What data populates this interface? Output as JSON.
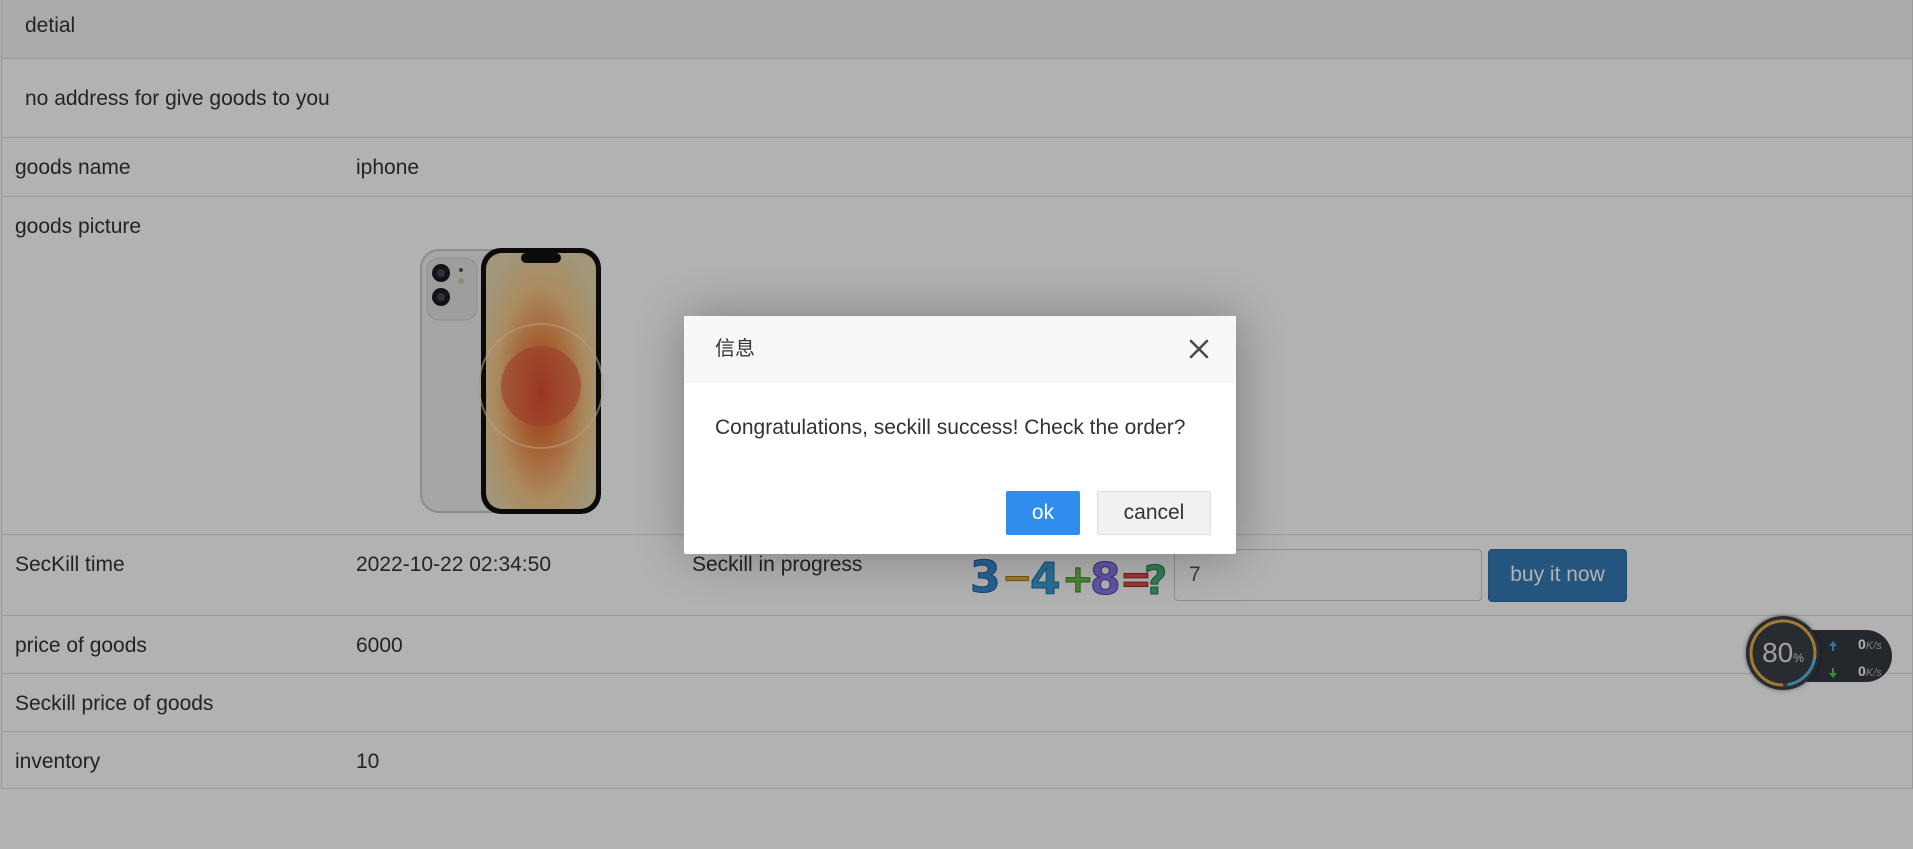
{
  "panel": {
    "heading": "detial",
    "address_message": "no address for give goods to you"
  },
  "goods": {
    "name_label": "goods name",
    "name_value": "iphone",
    "picture_label": "goods picture",
    "picture_alt": "iphone",
    "seckill_time_label": "SecKill time",
    "seckill_time_value": "2022-10-22 02:34:50",
    "seckill_status": "Seckill in progress",
    "captcha_text": "3-4+8=?",
    "captcha_answer": "7",
    "buy_button_label": "buy it now",
    "price_label": "price of goods",
    "price_value": "6000",
    "seckill_price_label": "Seckill price of goods",
    "seckill_price_value": "",
    "inventory_label": "inventory",
    "inventory_value": "10"
  },
  "dialog": {
    "title": "信息",
    "message": "Congratulations, seckill success! Check the order?",
    "ok_label": "ok",
    "cancel_label": "cancel",
    "close_icon": "close-icon"
  },
  "speed_widget": {
    "percent": "80",
    "percent_sign": "%",
    "upload": "0",
    "download": "0",
    "unit": "K/s"
  },
  "colors": {
    "primary_button": "#337ab7",
    "dialog_ok": "#2e8ded",
    "overlay": "rgba(0,0,0,0.30)"
  }
}
